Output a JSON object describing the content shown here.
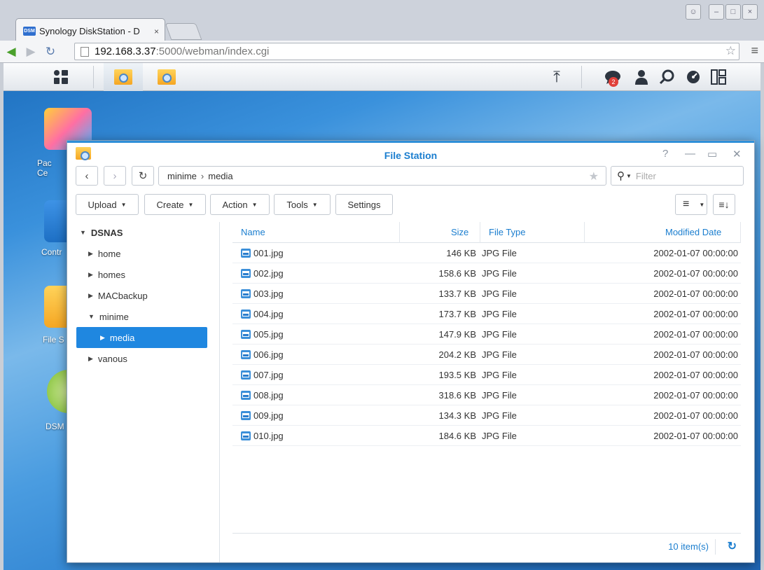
{
  "browser": {
    "tab_title": "Synology DiskStation - D",
    "tab_favicon": "DSM",
    "close_glyph": "×",
    "url_host": "192.168.3.37",
    "url_rest": ":5000/webman/index.cgi"
  },
  "taskbar": {
    "notification_count": "2"
  },
  "desktop": {
    "icons": [
      {
        "label": "Pac\nCe"
      },
      {
        "label": "Contr"
      },
      {
        "label": "File S"
      },
      {
        "label": "DSM"
      }
    ]
  },
  "window": {
    "title": "File Station",
    "path": [
      "minime",
      "media"
    ],
    "path_separator": "›",
    "filter_placeholder": "Filter"
  },
  "actions": {
    "upload": "Upload",
    "create": "Create",
    "action": "Action",
    "tools": "Tools",
    "settings": "Settings"
  },
  "tree": {
    "root": "DSNAS",
    "items": [
      {
        "label": "home",
        "expanded": false,
        "selected": false,
        "level": 1
      },
      {
        "label": "homes",
        "expanded": false,
        "selected": false,
        "level": 1
      },
      {
        "label": "MACbackup",
        "expanded": false,
        "selected": false,
        "level": 1
      },
      {
        "label": "minime",
        "expanded": true,
        "selected": false,
        "level": 1
      },
      {
        "label": "media",
        "expanded": false,
        "selected": true,
        "level": 2
      },
      {
        "label": "vanous",
        "expanded": false,
        "selected": false,
        "level": 1
      }
    ]
  },
  "grid": {
    "columns": {
      "name": "Name",
      "size": "Size",
      "type": "File Type",
      "modified": "Modified Date"
    },
    "rows": [
      {
        "name": "001.jpg",
        "size": "146 KB",
        "type": "JPG File",
        "modified": "2002-01-07 00:00:00"
      },
      {
        "name": "002.jpg",
        "size": "158.6 KB",
        "type": "JPG File",
        "modified": "2002-01-07 00:00:00"
      },
      {
        "name": "003.jpg",
        "size": "133.7 KB",
        "type": "JPG File",
        "modified": "2002-01-07 00:00:00"
      },
      {
        "name": "004.jpg",
        "size": "173.7 KB",
        "type": "JPG File",
        "modified": "2002-01-07 00:00:00"
      },
      {
        "name": "005.jpg",
        "size": "147.9 KB",
        "type": "JPG File",
        "modified": "2002-01-07 00:00:00"
      },
      {
        "name": "006.jpg",
        "size": "204.2 KB",
        "type": "JPG File",
        "modified": "2002-01-07 00:00:00"
      },
      {
        "name": "007.jpg",
        "size": "193.5 KB",
        "type": "JPG File",
        "modified": "2002-01-07 00:00:00"
      },
      {
        "name": "008.jpg",
        "size": "318.6 KB",
        "type": "JPG File",
        "modified": "2002-01-07 00:00:00"
      },
      {
        "name": "009.jpg",
        "size": "134.3 KB",
        "type": "JPG File",
        "modified": "2002-01-07 00:00:00"
      },
      {
        "name": "010.jpg",
        "size": "184.6 KB",
        "type": "JPG File",
        "modified": "2002-01-07 00:00:00"
      }
    ],
    "item_count": "10 item(s)"
  },
  "colors": {
    "accent": "#1b7ecf",
    "selection": "#1f87e0",
    "badge": "#e0403a"
  }
}
